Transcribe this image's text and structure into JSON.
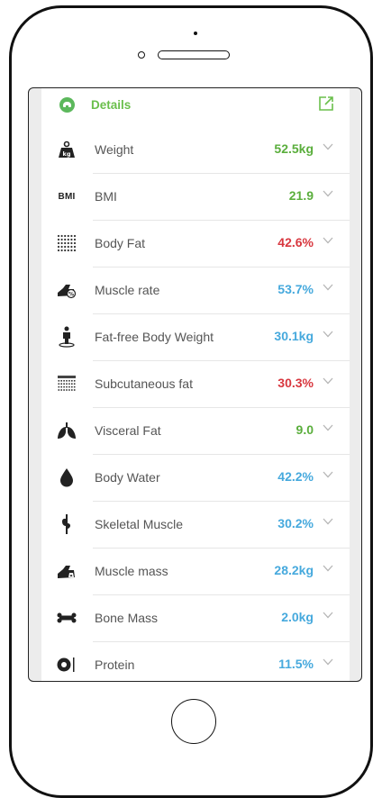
{
  "header": {
    "title": "Details",
    "icon": "details-icon",
    "action_icon": "edit-icon"
  },
  "metrics": [
    {
      "label": "Weight",
      "value": "52.5kg",
      "color": "#5aae3c",
      "icon": "weight-icon"
    },
    {
      "label": "BMI",
      "value": "21.9",
      "color": "#5aae3c",
      "icon": "bmi-icon",
      "icon_text": "BMI"
    },
    {
      "label": "Body Fat",
      "value": "42.6%",
      "color": "#d8373f",
      "icon": "body-fat-icon"
    },
    {
      "label": "Muscle rate",
      "value": "53.7%",
      "color": "#46a9dd",
      "icon": "muscle-rate-icon"
    },
    {
      "label": "Fat-free Body Weight",
      "value": "30.1kg",
      "color": "#46a9dd",
      "icon": "fat-free-body-weight-icon"
    },
    {
      "label": "Subcutaneous fat",
      "value": "30.3%",
      "color": "#d8373f",
      "icon": "subcutaneous-fat-icon"
    },
    {
      "label": "Visceral Fat",
      "value": "9.0",
      "color": "#5aae3c",
      "icon": "visceral-fat-icon"
    },
    {
      "label": "Body Water",
      "value": "42.2%",
      "color": "#46a9dd",
      "icon": "body-water-icon"
    },
    {
      "label": "Skeletal Muscle",
      "value": "30.2%",
      "color": "#46a9dd",
      "icon": "skeletal-muscle-icon"
    },
    {
      "label": "Muscle mass",
      "value": "28.2kg",
      "color": "#46a9dd",
      "icon": "muscle-mass-icon"
    },
    {
      "label": "Bone Mass",
      "value": "2.0kg",
      "color": "#46a9dd",
      "icon": "bone-mass-icon"
    },
    {
      "label": "Protein",
      "value": "11.5%",
      "color": "#46a9dd",
      "icon": "protein-icon"
    }
  ],
  "colors": {
    "accent_green": "#6abf4b",
    "value_green": "#5aae3c",
    "value_red": "#d8373f",
    "value_blue": "#46a9dd"
  }
}
